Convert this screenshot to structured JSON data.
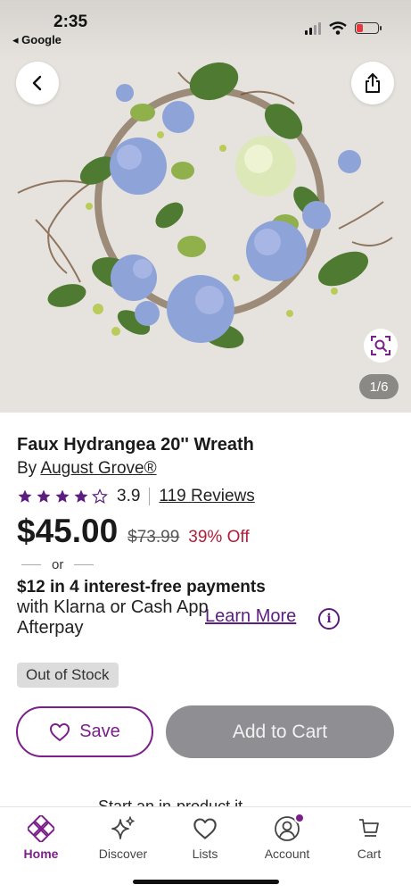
{
  "status": {
    "time": "2:35",
    "back_app": "◂ Google"
  },
  "gallery": {
    "counter": "1/6"
  },
  "product": {
    "title": "Faux Hydrangea 20'' Wreath",
    "by_prefix": "By",
    "brand": "August Grove®",
    "rating": "3.9",
    "rating_value": 3.9,
    "rating_max": 5,
    "reviews": "119 Reviews",
    "price": "$45.00",
    "old_price": "$73.99",
    "discount": "39% Off"
  },
  "financing": {
    "or": "or",
    "headline": "$12 in 4 interest-free payments",
    "body": "with Klarna or Cash App Afterpay",
    "learn_more": "Learn More"
  },
  "stock": {
    "label": "Out of Stock"
  },
  "actions": {
    "save": "Save",
    "add_to_cart": "Add to Cart"
  },
  "cutoff_text": "Start an in-product it",
  "nav": {
    "items": [
      {
        "label": "Home",
        "icon": "home-icon",
        "active": true
      },
      {
        "label": "Discover",
        "icon": "sparkle-icon"
      },
      {
        "label": "Lists",
        "icon": "heart-icon"
      },
      {
        "label": "Account",
        "icon": "account-icon"
      },
      {
        "label": "Cart",
        "icon": "cart-icon"
      }
    ]
  },
  "colors": {
    "brand": "#7b1f8a",
    "discount": "#b01e3a",
    "disabled_button": "#8e8e93"
  }
}
